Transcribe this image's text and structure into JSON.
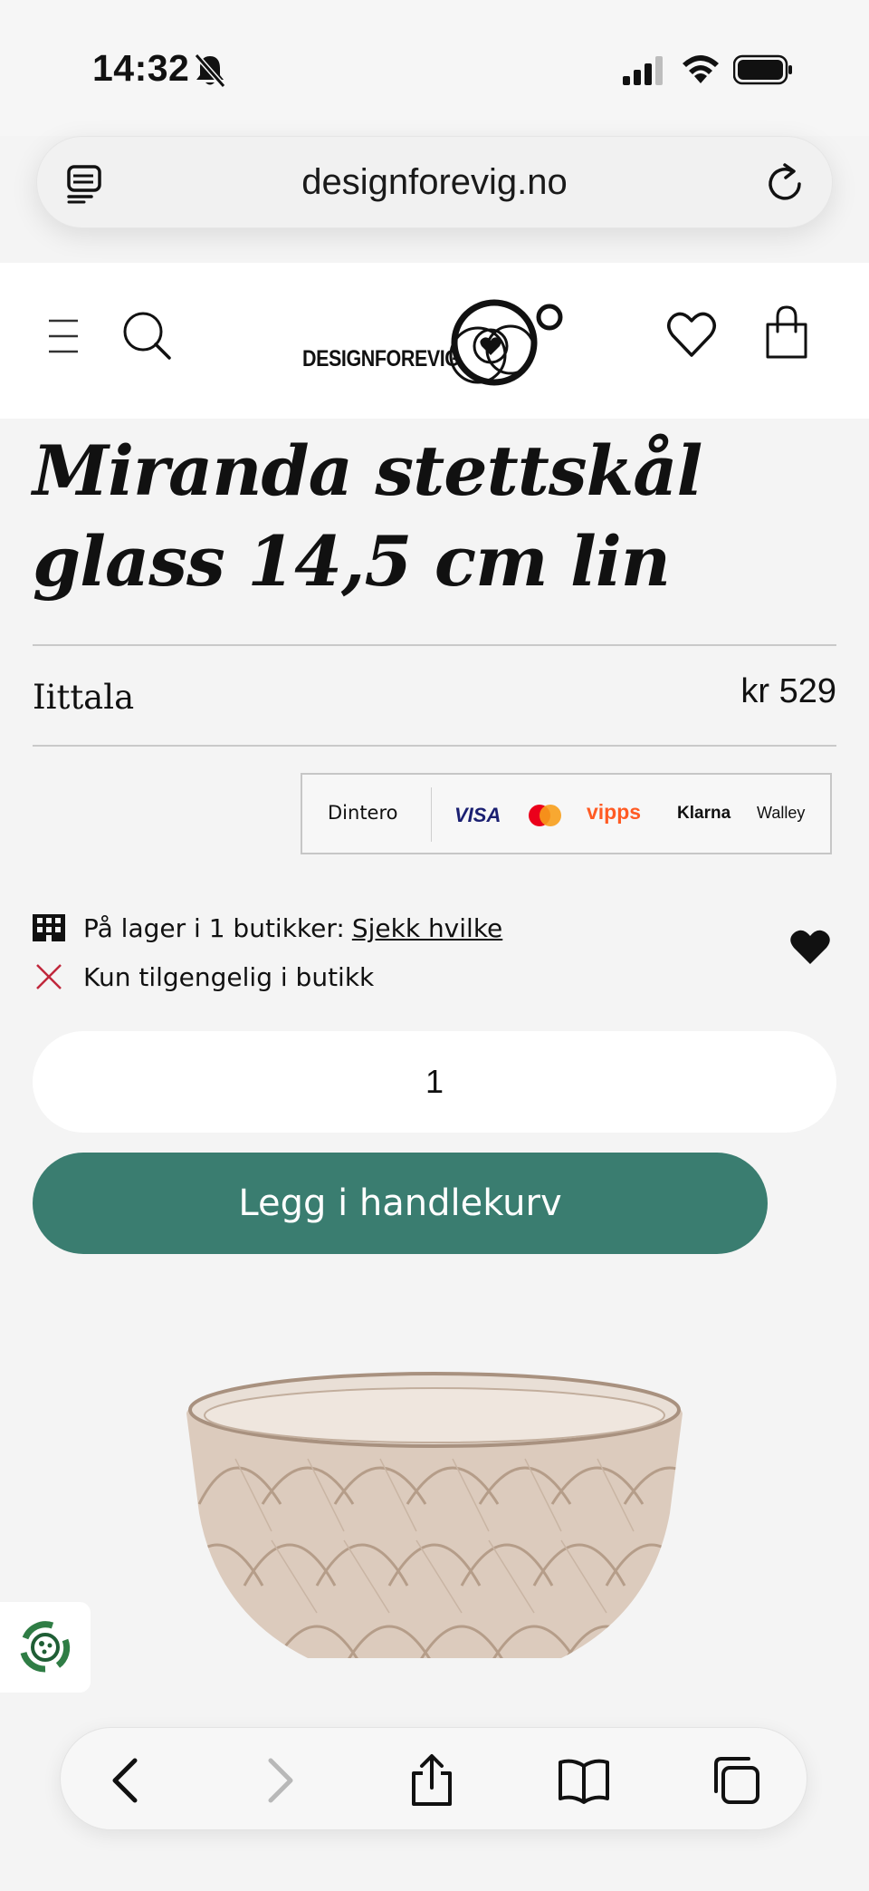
{
  "status_bar": {
    "time": "14:32",
    "icons": [
      "bell-slash-icon",
      "cellular-signal-icon",
      "wifi-icon",
      "battery-icon"
    ]
  },
  "browser": {
    "url": "designforevig.no",
    "left_icon": "reader-icon",
    "right_icon": "reload-icon"
  },
  "site_header": {
    "logo_text": "DESIGNFOREVIG",
    "icons": [
      "menu-icon",
      "search-icon",
      "wishlist-heart-icon",
      "shopping-bag-icon"
    ]
  },
  "product": {
    "title": "Miranda stettskål glass 14,5 cm lin",
    "brand": "Iittala",
    "price": "kr 529",
    "payment_methods": {
      "dintero": "Dintero",
      "visa": "VISA",
      "vipps": "vipps",
      "klarna": "Klarna",
      "walley": "Walley"
    },
    "stock_text": "På lager i 1 butikker:",
    "stock_link": "Sjekk hvilke",
    "availability_text": "Kun tilgengelig i butikk",
    "quantity": "1",
    "add_to_cart_label": "Legg i handlekurv",
    "accent_color": "#3a7d70"
  },
  "toolbar": {
    "icons": [
      "back-icon",
      "forward-icon",
      "share-icon",
      "bookmarks-icon",
      "tabs-icon"
    ]
  }
}
